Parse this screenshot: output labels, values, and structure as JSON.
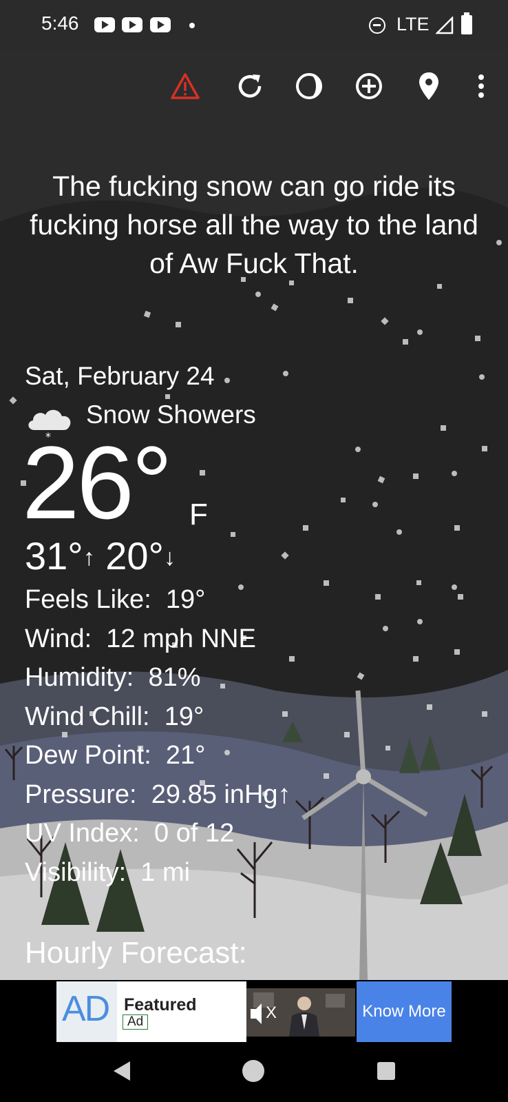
{
  "status_bar": {
    "time": "5:46",
    "network": "LTE",
    "notification_icons": [
      "youtube-icon",
      "youtube-icon",
      "youtube-icon"
    ]
  },
  "toolbar": {
    "icons": [
      "alert-icon",
      "refresh-icon",
      "theme-icon",
      "add-location-icon",
      "location-pin-icon",
      "more-vert-icon"
    ],
    "alert_color": "#d93025"
  },
  "quote": "The fucking snow can go ride its fucking horse all the way to the land of Aw Fuck That.",
  "weather": {
    "date": "Sat, February 24",
    "condition": "Snow Showers",
    "condition_icon": "snow-cloud-icon",
    "temperature": "26°",
    "unit": "F",
    "high": "31°",
    "high_arrow": "↑",
    "low": "20°",
    "low_arrow": "↓"
  },
  "details": [
    {
      "label": "Feels Like:",
      "value": "19°"
    },
    {
      "label": "Wind:",
      "value": "12 mph NNE"
    },
    {
      "label": "Humidity:",
      "value": "81%"
    },
    {
      "label": "Wind Chill:",
      "value": "19°"
    },
    {
      "label": "Dew Point:",
      "value": "21°"
    },
    {
      "label": "Pressure:",
      "value": "29.85 inHg↑"
    },
    {
      "label": "UV Index:",
      "value": "0 of 12"
    },
    {
      "label": "Visibility:",
      "value": "1 mi"
    }
  ],
  "hourly_title": "Hourly Forecast:",
  "ad": {
    "logo": "AD",
    "featured": "Featured",
    "tag": "Ad",
    "mute_label": "X",
    "cta": "Know More"
  },
  "nav": {
    "buttons": [
      "back-icon",
      "home-icon",
      "recents-icon"
    ]
  }
}
